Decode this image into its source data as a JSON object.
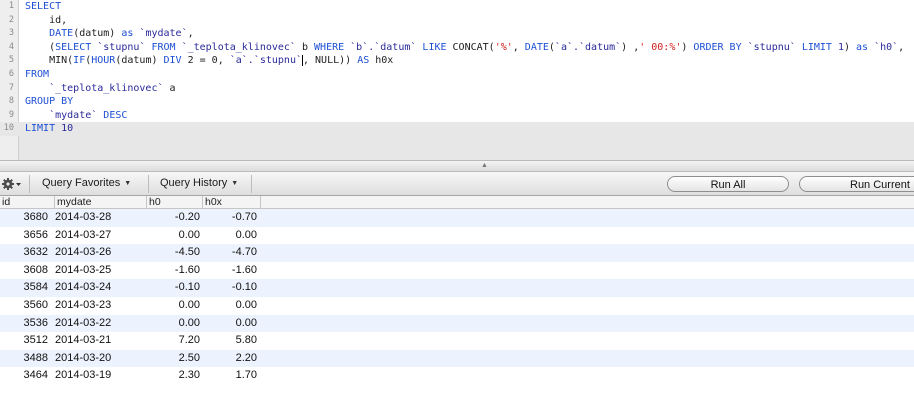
{
  "editor": {
    "lines": [
      {
        "n": "1",
        "segs": [
          {
            "t": "SELECT",
            "c": "kw"
          }
        ]
      },
      {
        "n": "2",
        "segs": [
          {
            "t": "    id,",
            "c": "plain"
          }
        ]
      },
      {
        "n": "3",
        "segs": [
          {
            "t": "    ",
            "c": "plain"
          },
          {
            "t": "DATE",
            "c": "kw"
          },
          {
            "t": "(datum) ",
            "c": "plain"
          },
          {
            "t": "as",
            "c": "kw"
          },
          {
            "t": " `mydate`",
            "c": "bq"
          },
          {
            "t": ",",
            "c": "plain"
          }
        ]
      },
      {
        "n": "4",
        "segs": [
          {
            "t": "    (",
            "c": "plain"
          },
          {
            "t": "SELECT",
            "c": "kw"
          },
          {
            "t": " `stupnu`",
            "c": "bq"
          },
          {
            "t": " ",
            "c": "plain"
          },
          {
            "t": "FROM",
            "c": "kw"
          },
          {
            "t": " `_teplota_klinovec`",
            "c": "bq"
          },
          {
            "t": " b ",
            "c": "plain"
          },
          {
            "t": "WHERE",
            "c": "kw"
          },
          {
            "t": " `b`.`datum`",
            "c": "bq"
          },
          {
            "t": " ",
            "c": "plain"
          },
          {
            "t": "LIKE",
            "c": "kw"
          },
          {
            "t": " CONCAT(",
            "c": "plain"
          },
          {
            "t": "'%'",
            "c": "str"
          },
          {
            "t": ", ",
            "c": "plain"
          },
          {
            "t": "DATE",
            "c": "kw"
          },
          {
            "t": "(",
            "c": "plain"
          },
          {
            "t": "`a`.`datum`",
            "c": "bq"
          },
          {
            "t": ") ,",
            "c": "plain"
          },
          {
            "t": "' 00:%'",
            "c": "str"
          },
          {
            "t": ") ",
            "c": "plain"
          },
          {
            "t": "ORDER BY",
            "c": "kw"
          },
          {
            "t": " `stupnu`",
            "c": "bq"
          },
          {
            "t": " ",
            "c": "plain"
          },
          {
            "t": "LIMIT",
            "c": "kw"
          },
          {
            "t": " 1",
            "c": "num"
          },
          {
            "t": ") ",
            "c": "plain"
          },
          {
            "t": "as",
            "c": "kw"
          },
          {
            "t": " `h0`",
            "c": "bq"
          },
          {
            "t": ",",
            "c": "plain"
          }
        ]
      },
      {
        "n": "5",
        "segs": [
          {
            "t": "    MIN(",
            "c": "plain"
          },
          {
            "t": "IF",
            "c": "kw"
          },
          {
            "t": "(",
            "c": "plain"
          },
          {
            "t": "HOUR",
            "c": "kw"
          },
          {
            "t": "(datum) ",
            "c": "plain"
          },
          {
            "t": "DIV",
            "c": "kw"
          },
          {
            "t": " 2 = 0, ",
            "c": "plain"
          },
          {
            "t": "`a`.`stupnu`",
            "c": "bq"
          },
          {
            "t": "|",
            "c": "caret"
          },
          {
            "t": ", NULL)) ",
            "c": "plain"
          },
          {
            "t": "AS",
            "c": "kw"
          },
          {
            "t": " h0x",
            "c": "plain"
          }
        ]
      },
      {
        "n": "6",
        "segs": [
          {
            "t": "FROM",
            "c": "kw"
          }
        ]
      },
      {
        "n": "7",
        "segs": [
          {
            "t": "    ",
            "c": "plain"
          },
          {
            "t": "`_teplota_klinovec`",
            "c": "bq"
          },
          {
            "t": " a",
            "c": "plain"
          }
        ]
      },
      {
        "n": "8",
        "segs": [
          {
            "t": "GROUP BY",
            "c": "kw"
          }
        ]
      },
      {
        "n": "9",
        "segs": [
          {
            "t": "    ",
            "c": "plain"
          },
          {
            "t": "`mydate`",
            "c": "bq"
          },
          {
            "t": " ",
            "c": "plain"
          },
          {
            "t": "DESC",
            "c": "kw"
          }
        ]
      },
      {
        "n": "10",
        "segs": [
          {
            "t": "LIMIT",
            "c": "kw"
          },
          {
            "t": " 10",
            "c": "num"
          }
        ]
      }
    ]
  },
  "toolbar": {
    "gear_icon": "gear-icon",
    "query_favorites_label": "Query Favorites",
    "query_history_label": "Query History",
    "run_all_label": "Run All",
    "run_current_label": "Run Current"
  },
  "results": {
    "columns": [
      "id",
      "mydate",
      "h0",
      "h0x"
    ],
    "rows": [
      [
        "3680",
        "2014-03-28",
        "-0.20",
        "-0.70"
      ],
      [
        "3656",
        "2014-03-27",
        "0.00",
        "0.00"
      ],
      [
        "3632",
        "2014-03-26",
        "-4.50",
        "-4.70"
      ],
      [
        "3608",
        "2014-03-25",
        "-1.60",
        "-1.60"
      ],
      [
        "3584",
        "2014-03-24",
        "-0.10",
        "-0.10"
      ],
      [
        "3560",
        "2014-03-23",
        "0.00",
        "0.00"
      ],
      [
        "3536",
        "2014-03-22",
        "0.00",
        "0.00"
      ],
      [
        "3512",
        "2014-03-21",
        "7.20",
        "5.80"
      ],
      [
        "3488",
        "2014-03-20",
        "2.50",
        "2.20"
      ],
      [
        "3464",
        "2014-03-19",
        "2.30",
        "1.70"
      ]
    ]
  },
  "colors": {
    "keyword": "#1d4fd4",
    "string": "#d21d1d",
    "alt_row": "#edf3fe"
  }
}
